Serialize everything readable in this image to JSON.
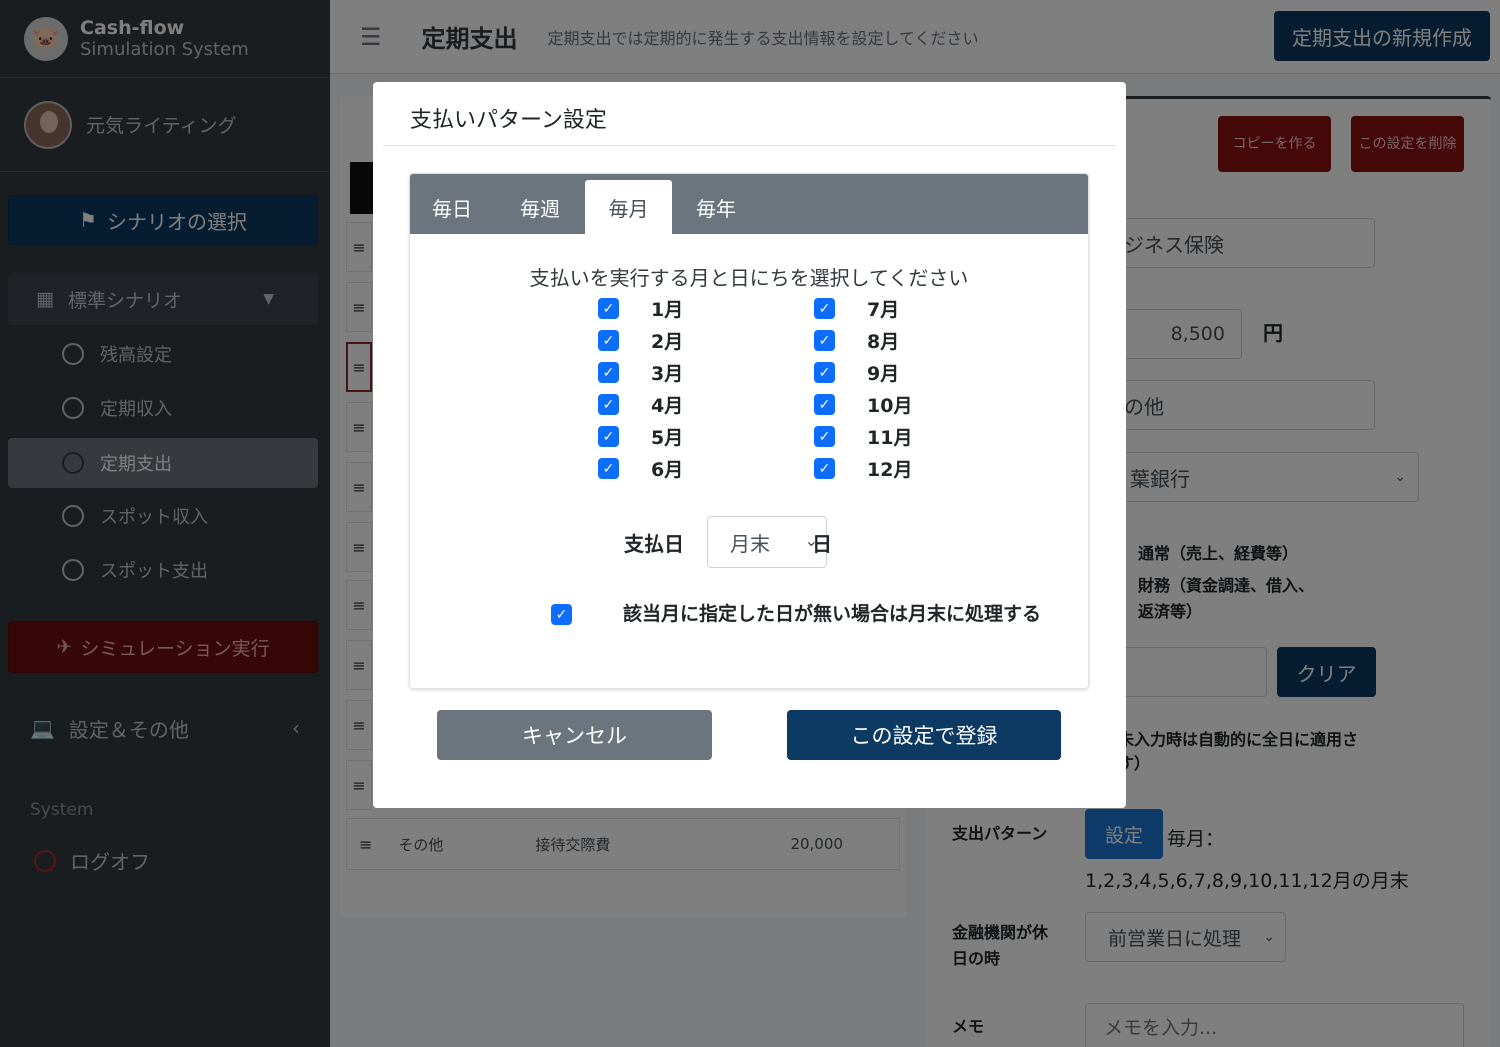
{
  "sidebar": {
    "brand_title": "Cash-flow",
    "brand_subtitle": "Simulation System",
    "user_name": "元気ライティング",
    "scenario_button": "シナリオの選択",
    "group_label": "標準シナリオ",
    "items": [
      {
        "label": "残高設定"
      },
      {
        "label": "定期収入"
      },
      {
        "label": "定期支出"
      },
      {
        "label": "スポット収入"
      },
      {
        "label": "スポット支出"
      }
    ],
    "simulate_button": "シミュレーション実行",
    "settings_label": "設定＆その他",
    "system_label": "System",
    "logoff_label": "ログオフ"
  },
  "header": {
    "title": "定期支出",
    "subtitle": "定期支出では定期的に発生する支出情報を設定してください",
    "new_button": "定期支出の新規作成"
  },
  "list": {
    "last_row": {
      "category": "その他",
      "item": "接待交際費",
      "amount": "20,000"
    }
  },
  "detail": {
    "copy_button": "コピーを作る",
    "delete_button": "この設定を削除",
    "name_value": "ジネス保険",
    "amount_value": "8,500",
    "amount_unit": "円",
    "category_value": "の他",
    "bank_value": "葉銀行",
    "type_option1": "通常（売上、経費等）",
    "type_option2": "財務（資金調達、借入、返済等）",
    "clear_button": "クリア",
    "auto_note": "未入力時は自動的に全日に適用さ",
    "auto_note2": "す）",
    "pattern_label": "支出パターン",
    "pattern_button": "設定",
    "pattern_value": "毎月：1,2,3,4,5,6,7,8,9,10,11,12月の月末",
    "holiday_label": "金融機関が休日の時",
    "holiday_value": "前営業日に処理",
    "memo_label": "メモ",
    "memo_placeholder": "メモを入力..."
  },
  "modal": {
    "title": "支払いパターン設定",
    "tabs": [
      {
        "label": "毎日"
      },
      {
        "label": "毎週"
      },
      {
        "label": "毎月"
      },
      {
        "label": "毎年"
      }
    ],
    "active_tab": "毎月",
    "prompt": "支払いを実行する月と日にちを選択してください",
    "months_left": [
      {
        "label": "1月",
        "checked": true
      },
      {
        "label": "2月",
        "checked": true
      },
      {
        "label": "3月",
        "checked": true
      },
      {
        "label": "4月",
        "checked": true
      },
      {
        "label": "5月",
        "checked": true
      },
      {
        "label": "6月",
        "checked": true
      }
    ],
    "months_right": [
      {
        "label": "7月",
        "checked": true
      },
      {
        "label": "8月",
        "checked": true
      },
      {
        "label": "9月",
        "checked": true
      },
      {
        "label": "10月",
        "checked": true
      },
      {
        "label": "11月",
        "checked": true
      },
      {
        "label": "12月",
        "checked": true
      }
    ],
    "payday_label": "支払日",
    "payday_value": "月末",
    "day_suffix": "日",
    "month_end_note": "該当月に指定した日が無い場合は月末に処理する",
    "cancel_button": "キャンセル",
    "register_button": "この設定で登録"
  }
}
